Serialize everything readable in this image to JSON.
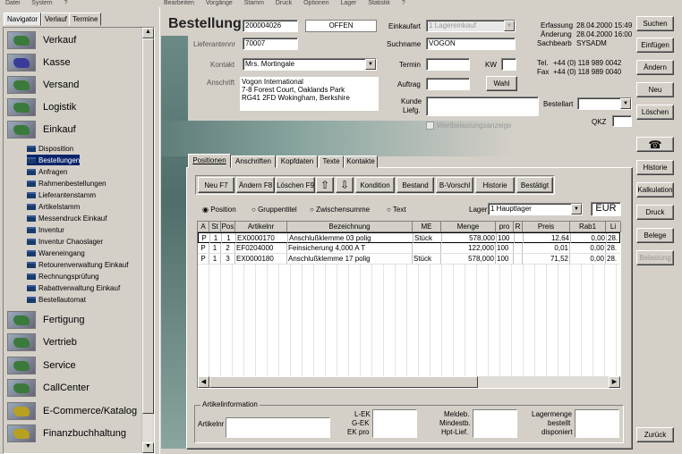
{
  "menu": {
    "left": [
      "Datei",
      "System",
      "?"
    ],
    "right": [
      "Bearbeiten",
      "Vorgänge",
      "Stamm",
      "Druck",
      "Optionen",
      "Lager",
      "Statistik",
      "?"
    ]
  },
  "nav": {
    "tabs": [
      "Navigator",
      "Verlauf",
      "Termine"
    ],
    "categories_top": [
      "Verkauf",
      "Kasse",
      "Versand",
      "Logistik",
      "Einkauf"
    ],
    "einkauf_items": [
      "Disposition",
      "Bestellungen",
      "Anfragen",
      "Rahmenbestellungen",
      "Lieferantenstamm",
      "Artikelstamm",
      "Messendruck Einkauf",
      "Inventur",
      "Inventur Chaoslager",
      "Wareneingang",
      "Retourenverwaltung Einkauf",
      "Rechnungsprüfung",
      "Rabattverwaltung Einkauf",
      "Bestellautomat"
    ],
    "selected_item": "Bestellungen",
    "categories_bottom": [
      "Fertigung",
      "Vertrieb",
      "Service",
      "CallCenter",
      "E-Commerce/Katalog",
      "Finanzbuchhaltung"
    ]
  },
  "header": {
    "title": "Bestellung",
    "order_no": "200004026",
    "status": "OFFEN",
    "lieferantennr_label": "Lieferantennr",
    "lieferantennr": "70007",
    "kontakt_label": "Kontakt",
    "kontakt": "Mrs. Mortingale",
    "anschrift_label": "Anschrift",
    "anschrift": [
      "Vogon International",
      "7-8 Forest Court, Oaklands Park",
      "RG41 2FD Wokingham,  Berkshire"
    ],
    "einkaufart_label": "Einkaufart",
    "einkaufart": "1 Lagereinkauf",
    "suchname_label": "Suchname",
    "suchname": "VOGON",
    "termin_label": "Termin",
    "kw_label": "KW",
    "auftrag_label": "Auftrag",
    "wahl_label": "Wahl",
    "kunde_label": "Kunde",
    "liefg_label": "Liefg.",
    "wertbelastung_label": "Wertbelastungsanzeige",
    "erfassung_label": "Erfassung",
    "erfassung": "28.04.2000 15:49",
    "aenderung_label": "Änderung",
    "aenderung": "28.04.2000 16:00",
    "sachbearb_label": "Sachbearb",
    "sachbearb": "SYSADM",
    "tel_label": "Tel.",
    "tel": "+44 (0) 118 989 0042",
    "fax_label": "Fax",
    "fax": "+44 (0) 118 989 0040",
    "bestellart_label": "Bestellart",
    "qkz_label": "QKZ"
  },
  "tabs": [
    "Positionen",
    "Anschriften",
    "Kopfdaten",
    "Texte",
    "Kontakte"
  ],
  "toolbar": [
    "Neu F7",
    "Ändern F8",
    "Löschen F9",
    "⇧",
    "⇩",
    "Kondition",
    "Bestand",
    "B-Vorschl",
    "Historie",
    "Bestätigt"
  ],
  "radios": [
    "Position",
    "Gruppentitel",
    "Zwischensumme",
    "Text"
  ],
  "lager_label": "Lager",
  "lager": "1 Hauptlager",
  "currency": "EUR",
  "table": {
    "columns": [
      "A",
      "St",
      "Pos",
      "Artikelnr",
      "Bezeichnung",
      "ME",
      "Menge",
      "pro",
      "R",
      "Preis",
      "Rab1",
      "Li"
    ],
    "rows": [
      [
        "P",
        "1",
        "1",
        "EX0000170",
        "Anschlußklemme 03 polig",
        "Stück",
        "578,000",
        "100",
        "",
        "12,64",
        "0,00",
        "28."
      ],
      [
        "P",
        "1",
        "2",
        "EF0204000",
        "Feinsicherung 4,000 A T",
        "",
        "122,000",
        "100",
        "",
        "0,01",
        "0,00",
        "28."
      ],
      [
        "P",
        "1",
        "3",
        "EX0000180",
        "Anschlußklemme 17 polig",
        "Stück",
        "578,000",
        "100",
        "",
        "71,52",
        "0,00",
        "28."
      ]
    ]
  },
  "artikelinfo": {
    "title": "Artikelinformation",
    "artikelnr_label": "Artikelnr",
    "lek_label": "L-EK",
    "gek_label": "G-EK",
    "ekpro_label": "EK pro",
    "meldeb_label": "Meldeb.",
    "mindestb_label": "Mindestb.",
    "hptlief_label": "Hpt-Lief.",
    "lagermenge_label": "Lagermenge",
    "bestellt_label": "bestellt",
    "disponiert_label": "disponiert"
  },
  "right_buttons": [
    "Suchen",
    "Einfügen",
    "Ändern",
    "Neu",
    "Löschen",
    "☎",
    "Historie",
    "Kalkulation",
    "Druck",
    "Belege",
    "Belastung",
    "Zurück"
  ]
}
